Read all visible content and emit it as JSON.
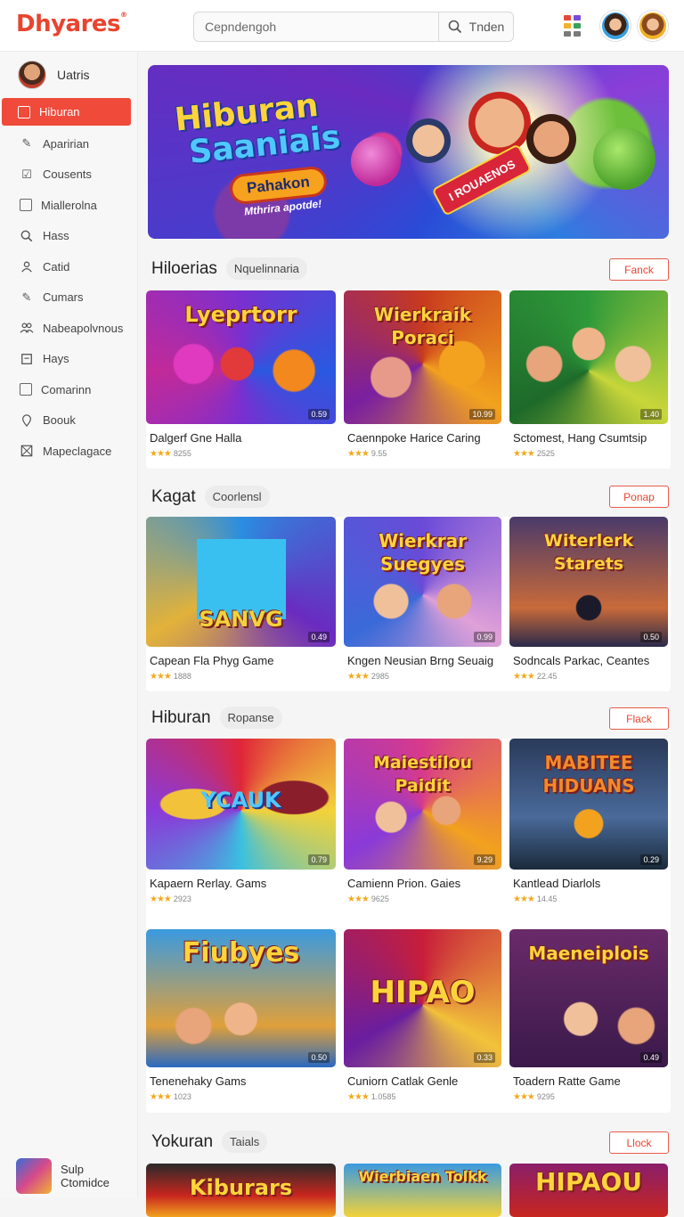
{
  "header": {
    "logo": "Dhyares",
    "search_placeholder": "Cepndengoh",
    "search_button": "Tnden"
  },
  "sidebar": {
    "profile_name": "Uatris",
    "items": [
      {
        "label": "Hiburan",
        "icon": "bookmark-icon",
        "active": true
      },
      {
        "label": "Aparirian",
        "icon": "edit-icon"
      },
      {
        "label": "Cousents",
        "icon": "check-square-icon"
      },
      {
        "label": "Miallerolna",
        "icon": "square-icon"
      },
      {
        "label": "Hass",
        "icon": "search-icon"
      },
      {
        "label": "Catid",
        "icon": "user-icon"
      },
      {
        "label": "Cumars",
        "icon": "edit-icon"
      },
      {
        "label": "Nabeapolvnous",
        "icon": "people-icon"
      },
      {
        "label": "Hays",
        "icon": "document-icon"
      },
      {
        "label": "Comarinn",
        "icon": "square-icon"
      },
      {
        "label": "Boouk",
        "icon": "pin-icon"
      },
      {
        "label": "Mapeclagace",
        "icon": "map-icon"
      }
    ],
    "bottom_line1": "Sulp",
    "bottom_line2": "Ctomidce"
  },
  "hero": {
    "title_line1": "Hiburan",
    "title_line2": "Saaniais",
    "pill": "Pahakon",
    "tagline": "Mthrira apotde!",
    "ribbon": "I ROUAENOS"
  },
  "sections": [
    {
      "title": "Hiloerias",
      "chip": "Nquelinnaria",
      "button": "Fanck",
      "cards": [
        {
          "art": "Lyeprtorr",
          "price": "0.59",
          "name": "Dalgerf Gne Halla",
          "rating": "8255",
          "colors": [
            "#7a2fd0",
            "#2a58e0",
            "#e24a6a"
          ]
        },
        {
          "art": "Wierkraik Poraci",
          "price": "10.99",
          "name": "Caennpoke Harice Caring",
          "rating": "9.55",
          "colors": [
            "#c83a1e",
            "#f2a21e",
            "#7a1fa0"
          ]
        },
        {
          "art": "",
          "price": "1.40",
          "name": "Sctomest, Hang Csumtsip",
          "rating": "2525",
          "colors": [
            "#2f9a3a",
            "#c8d63a",
            "#1e6a2a"
          ]
        }
      ]
    },
    {
      "title": "Kagat",
      "chip": "Coorlensl",
      "button": "Ponap",
      "cards": [
        {
          "art": "SANVG",
          "price": "0.49",
          "name": "Capean Fla Phyg Game",
          "rating": "1888",
          "colors": [
            "#2a8ee0",
            "#6a2bc0",
            "#e2b23a"
          ]
        },
        {
          "art": "Wierkrar Suegyes",
          "price": "0.99",
          "name": "Kngen Neusian Brng Seuaig",
          "rating": "2985",
          "colors": [
            "#6a4ad8",
            "#e0a0d8",
            "#3a6ad8"
          ]
        },
        {
          "art": "Witerlerk Starets",
          "price": "0.50",
          "name": "Sodncals Parkac, Ceantes",
          "rating": "22.45",
          "colors": [
            "#4a3a6a",
            "#c86a3a",
            "#2a2a4a"
          ]
        }
      ]
    },
    {
      "title": "Hiburan",
      "chip": "Ropanse",
      "button": "Flack",
      "cards": [
        {
          "art": "YCAUK",
          "price": "0.79",
          "name": "Kapaern Rerlay. Gams",
          "rating": "2923",
          "colors": [
            "#e0263a",
            "#3ac0e0",
            "#f2d23a"
          ]
        },
        {
          "art": "Maiestilou Paidit",
          "price": "9.29",
          "name": "Camienn Prion. Gaies",
          "rating": "9625",
          "colors": [
            "#d83a8a",
            "#f2a21e",
            "#8a3ad8"
          ]
        },
        {
          "art": "MABITEE HIDUANS",
          "price": "0.29",
          "name": "Kantlead Diarlols",
          "rating": "14.45",
          "colors": [
            "#2a3a5a",
            "#4a6a9a",
            "#1a2a3a"
          ]
        },
        {
          "art": "Fiubyes",
          "price": "0.50",
          "name": "Tenenehaky Gams",
          "rating": "1023",
          "colors": [
            "#3a9ae0",
            "#e0a03a",
            "#2a6ac0"
          ]
        },
        {
          "art": "HIPAO",
          "price": "0.33",
          "name": "Cuniorn Catlak Genle",
          "rating": "1.0585",
          "colors": [
            "#c81e3a",
            "#f2c23a",
            "#6a1ea0"
          ]
        },
        {
          "art": "Maeneiplois",
          "price": "0.49",
          "name": "Toadern Ratte Game",
          "rating": "9295",
          "colors": [
            "#6a2a6a",
            "#e0a03a",
            "#3a1a4a"
          ]
        }
      ]
    },
    {
      "title": "Yokuran",
      "chip": "Taials",
      "button": "Llock",
      "cards": [
        {
          "art": "Kiburars",
          "colors": [
            "#c8261e",
            "#f2a21e",
            "#2a2a2a"
          ]
        },
        {
          "art": "Wierbiaen Tolkk",
          "colors": [
            "#3a9ae0",
            "#f2d23a",
            "#2a6ac0"
          ]
        },
        {
          "art": "HIPAOU",
          "colors": [
            "#8a1e6a",
            "#f2c23a",
            "#c8261e"
          ]
        }
      ]
    }
  ]
}
